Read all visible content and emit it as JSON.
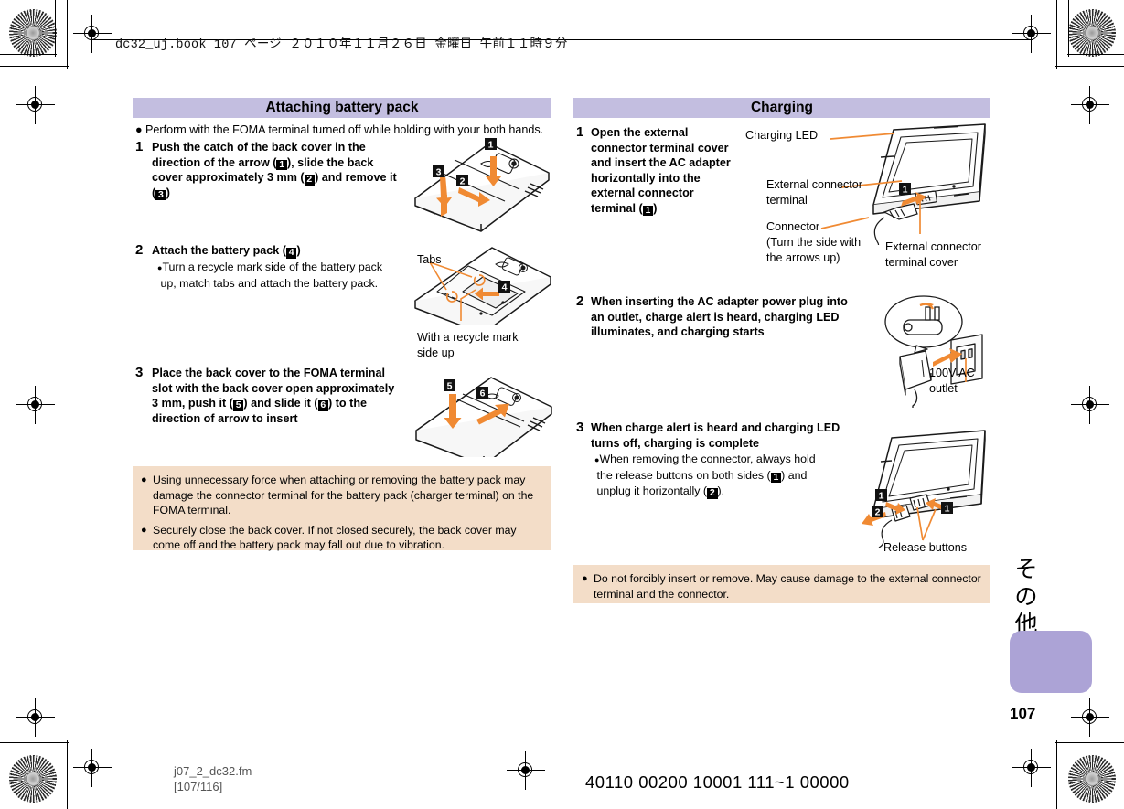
{
  "page_header": {
    "text": "dc32_uj.book    107 ページ    ２０１０年１１月２６日    金曜日    午前１１時９分"
  },
  "left_column": {
    "section_title": "Attaching battery pack",
    "intro_bullet": "Perform with the FOMA terminal turned off while holding with your both hands.",
    "steps": [
      {
        "num": "1",
        "lines": [
          {
            "parts": [
              {
                "t": "Push the catch of the back cover in the"
              }
            ]
          },
          {
            "parts": [
              {
                "t": "direction of the arrow ("
              },
              {
                "m": "1"
              },
              {
                "t": "), slide the back"
              }
            ]
          },
          {
            "parts": [
              {
                "t": "cover approximately 3 mm ("
              },
              {
                "m": "2"
              },
              {
                "t": ") and remove it"
              }
            ]
          },
          {
            "parts": [
              {
                "t": "("
              },
              {
                "m": "3"
              },
              {
                "t": ")"
              }
            ]
          }
        ]
      },
      {
        "num": "2",
        "lines": [
          {
            "parts": [
              {
                "t": "Attach the battery pack ("
              },
              {
                "m": "4"
              },
              {
                "t": ")"
              }
            ]
          }
        ],
        "bullets": [
          "Turn a recycle mark side of the battery pack",
          "up, match tabs and attach the battery pack."
        ]
      },
      {
        "num": "3",
        "lines": [
          {
            "parts": [
              {
                "t": "Place the back cover to the FOMA terminal"
              }
            ]
          },
          {
            "parts": [
              {
                "t": "slot with the back cover open approximately"
              }
            ]
          },
          {
            "parts": [
              {
                "t": "3 mm, push it ("
              },
              {
                "m": "5"
              },
              {
                "t": ") and slide it ("
              },
              {
                "m": "6"
              },
              {
                "t": ") to the"
              }
            ]
          },
          {
            "parts": [
              {
                "t": "direction of arrow to insert"
              }
            ]
          }
        ]
      }
    ],
    "illustration_labels": {
      "tabs": "Tabs",
      "recycle_mark_line1": "With a recycle mark",
      "recycle_mark_line2": "side up"
    },
    "note": {
      "bullet_char": "●",
      "items": [
        "Using unnecessary force when attaching or removing the battery pack may damage the connector terminal for the battery pack (charger terminal) on the FOMA terminal.",
        "Securely close the back cover. If not closed securely, the back cover may come off and the battery pack may fall out due to vibration."
      ]
    }
  },
  "right_column": {
    "section_title": "Charging",
    "steps": [
      {
        "num": "1",
        "lines": [
          {
            "parts": [
              {
                "t": "Open the external"
              }
            ]
          },
          {
            "parts": [
              {
                "t": "connector terminal cover"
              }
            ]
          },
          {
            "parts": [
              {
                "t": "and insert the AC adapter"
              }
            ]
          },
          {
            "parts": [
              {
                "t": "horizontally into the"
              }
            ]
          },
          {
            "parts": [
              {
                "t": "external connector"
              }
            ]
          },
          {
            "parts": [
              {
                "t": "terminal ("
              },
              {
                "m": "1"
              },
              {
                "t": ")"
              }
            ]
          }
        ]
      },
      {
        "num": "2",
        "lines": [
          {
            "parts": [
              {
                "t": "When inserting the AC adapter power plug into"
              }
            ]
          },
          {
            "parts": [
              {
                "t": "an outlet, charge alert is heard, charging LED"
              }
            ]
          },
          {
            "parts": [
              {
                "t": "illuminates, and charging starts"
              }
            ]
          }
        ]
      },
      {
        "num": "3",
        "lines": [
          {
            "parts": [
              {
                "t": "When charge alert is heard and charging LED"
              }
            ]
          },
          {
            "parts": [
              {
                "t": "turns off, charging is complete"
              }
            ]
          }
        ],
        "bullets_rich": [
          {
            "parts": [
              {
                "t": "When removing the connector, always hold"
              }
            ]
          },
          {
            "parts": [
              {
                "t": "the release buttons on both sides ("
              },
              {
                "m": "1"
              },
              {
                "t": ") and"
              }
            ]
          },
          {
            "parts": [
              {
                "t": "unplug it horizontally ("
              },
              {
                "m": "2"
              },
              {
                "t": ")."
              }
            ]
          }
        ]
      }
    ],
    "illustration_labels": {
      "charging_led": "Charging LED",
      "external_connector_terminal_l1": "External connector",
      "external_connector_terminal_l2": "terminal",
      "connector": "Connector",
      "connector_note_l1": "(Turn the side with",
      "connector_note_l2": "the arrows up)",
      "external_connector_cover_l1": "External connector",
      "external_connector_cover_l2": "terminal cover",
      "ac_outlet_l1": "100V AC",
      "ac_outlet_l2": "outlet",
      "release_buttons": "Release buttons"
    },
    "note": {
      "bullet_char": "●",
      "items": [
        "Do not forcibly insert or remove. May cause damage to the external connector terminal and the connector."
      ]
    }
  },
  "side_tab": {
    "label_chars": [
      "そ",
      "の",
      "他"
    ],
    "page_number": "107"
  },
  "footer": {
    "file_name": "j07_2_dc32.fm",
    "page_range": "[107/116]",
    "code": "40110 00200 10001 111~1 00000"
  },
  "colors": {
    "band": "#c3bee0",
    "note_bg": "#f3ddc8",
    "tab_box": "#aca3d6",
    "arrow_orange": "#f08a33",
    "line_art": "#1a1a1a"
  }
}
